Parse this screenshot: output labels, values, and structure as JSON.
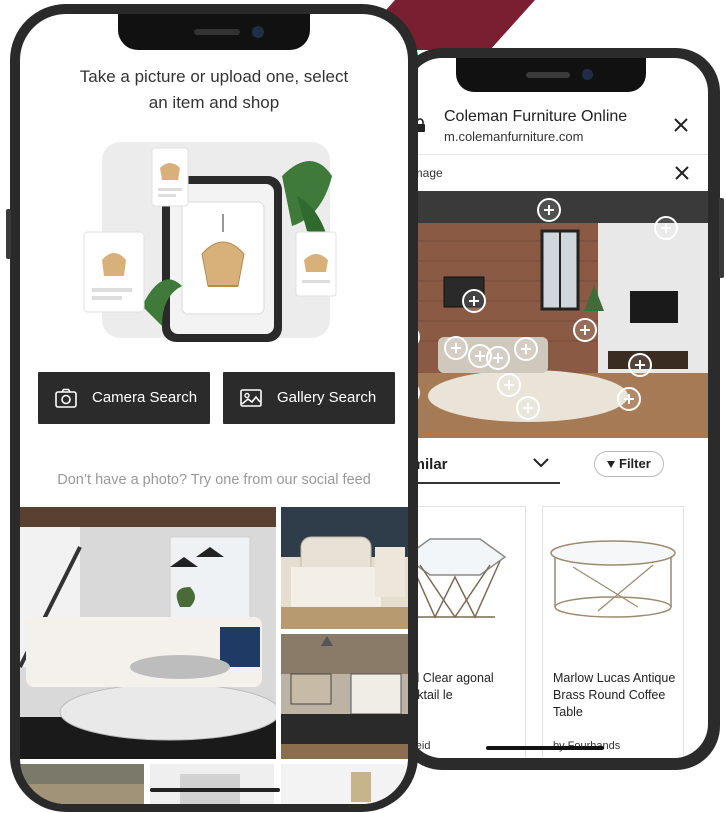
{
  "front": {
    "headline_line1": "Take a picture or upload one, select",
    "headline_line2": "an item and shop",
    "camera_button": "Camera Search",
    "gallery_button": "Gallery Search",
    "social_hint": "Don’t have a photo? Try one from our social feed"
  },
  "back": {
    "site_title": "Coleman Furniture Online",
    "site_url": "m.colemanfurniture.com",
    "view_label": "w image",
    "sort_label": "t similar",
    "filter_label": "Filter",
    "products": [
      {
        "name": "eted Clear agonal Cocktail le",
        "brand": "Sarreid"
      },
      {
        "name": "Marlow Lucas Antique Brass Round Coffee Table",
        "brand": "by Fourhands"
      }
    ]
  },
  "colors": {
    "accent": "#7a1e31",
    "button_bg": "#2b2b2b",
    "phone_body": "#2a2a2a"
  }
}
